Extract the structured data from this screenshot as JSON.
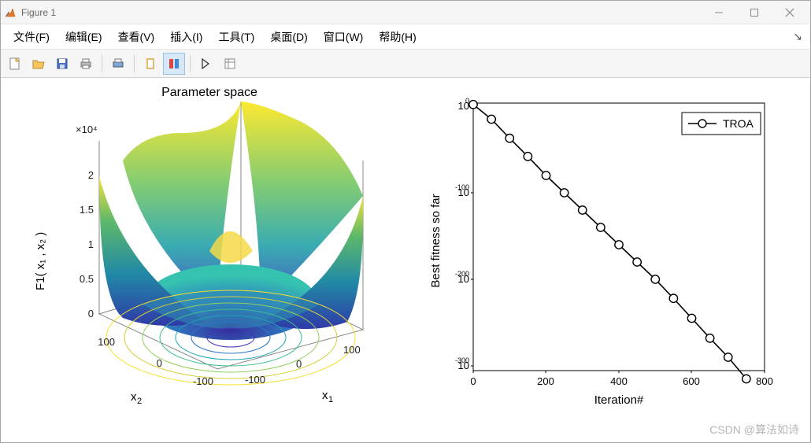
{
  "window": {
    "title": "Figure 1"
  },
  "menu": {
    "file": "文件(F)",
    "edit": "编辑(E)",
    "view": "查看(V)",
    "insert": "插入(I)",
    "tools": "工具(T)",
    "desktop": "桌面(D)",
    "window": "窗口(W)",
    "help": "帮助(H)"
  },
  "toolbar_icons": {
    "new": "new-figure-icon",
    "open": "open-icon",
    "save": "save-icon",
    "print": "print-icon",
    "printpreview": "print-preview-icon",
    "link": "link-icon",
    "legend": "legend-icon",
    "cursor": "cursor-icon",
    "property": "property-icon"
  },
  "chart_data": [
    {
      "type": "surface3d",
      "title": "Parameter space",
      "xlabel": "x₁",
      "ylabel": "x₂",
      "zlabel": "F1( x₁ , x₂ )",
      "x_range": [
        -100,
        100
      ],
      "y_range": [
        -100,
        100
      ],
      "x_ticks": [
        -100,
        0,
        100
      ],
      "y_ticks": [
        -100,
        0,
        100
      ],
      "z_ticks": [
        0,
        0.5,
        1,
        1.5,
        2
      ],
      "z_exponent": "×10⁴",
      "function": "F1(x1,x2) = x1^2 + x2^2 (Sphere)",
      "colormap": "parula",
      "has_contour": true
    },
    {
      "type": "line",
      "xlabel": "Iteration#",
      "ylabel": "Best fitness so far",
      "yscale": "log",
      "x_ticks": [
        0,
        200,
        400,
        600,
        800
      ],
      "y_ticks": [
        "10⁰",
        "10⁻¹⁰⁰",
        "10⁻²⁰⁰",
        "10⁻³⁰⁰"
      ],
      "legend": {
        "entries": [
          "TROA"
        ],
        "marker": "circle",
        "line": "solid-black"
      },
      "x": [
        0,
        50,
        100,
        150,
        200,
        250,
        300,
        350,
        400,
        450,
        500,
        550,
        600,
        650,
        700,
        750
      ],
      "y_exponent": [
        2,
        -15,
        -37,
        -58,
        -80,
        -100,
        -120,
        -140,
        -160,
        -180,
        -200,
        -222,
        -245,
        -268,
        -290,
        -315
      ]
    }
  ],
  "watermark": "CSDN @算法如诗"
}
